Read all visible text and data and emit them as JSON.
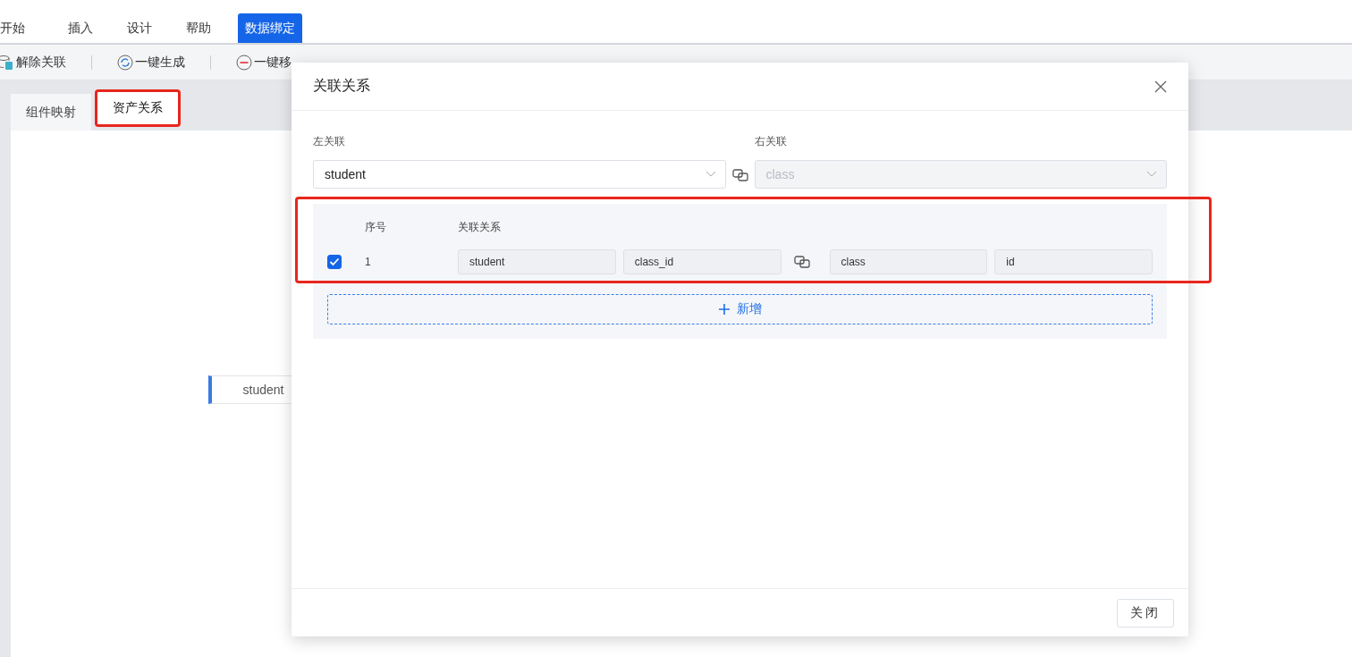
{
  "menu_tabs": [
    {
      "label": "开始",
      "selected": false
    },
    {
      "label": "插入",
      "selected": false
    },
    {
      "label": "设计",
      "selected": false
    },
    {
      "label": "帮助",
      "selected": false
    },
    {
      "label": "数据绑定",
      "selected": true
    }
  ],
  "toolbar": [
    {
      "label": "解除关联"
    },
    {
      "label": "一键生成"
    },
    {
      "label": "一键移"
    }
  ],
  "page_tabs": [
    {
      "label": "组件映射",
      "selected": false,
      "highlighted": false
    },
    {
      "label": "资产关系",
      "selected": true,
      "highlighted": true
    }
  ],
  "canvas_node": {
    "label": "student"
  },
  "dialog": {
    "title": "关联关系",
    "left": {
      "label": "左关联",
      "value": "student",
      "disabled": false
    },
    "right": {
      "label": "右关联",
      "value": "class",
      "disabled": true
    },
    "table": {
      "highlighted": true,
      "columns": [
        "序号",
        "关联关系"
      ],
      "rows": [
        {
          "checked": true,
          "index": "1",
          "fields": [
            "student",
            "class_id",
            "class",
            "id"
          ]
        }
      ]
    },
    "add_button": "新增",
    "close_button": "关闭"
  }
}
